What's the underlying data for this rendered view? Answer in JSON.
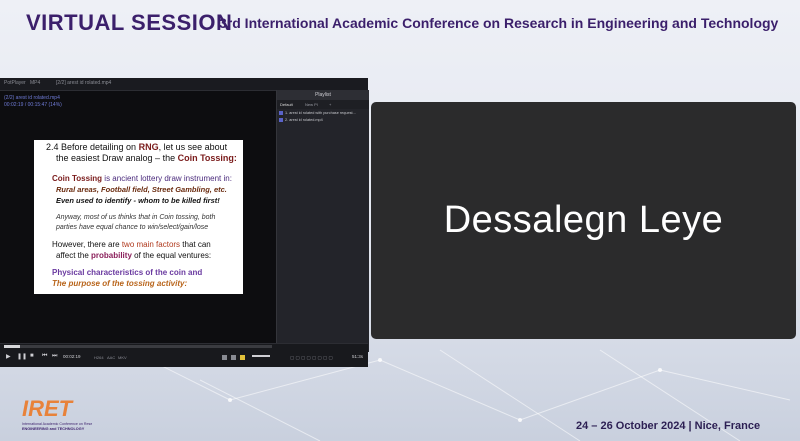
{
  "header": {
    "session": "VIRTUAL SESSION",
    "conference": "3rd International Academic Conference on Research in Engineering and Technology"
  },
  "player": {
    "app_name": "PotPlayer",
    "tab_label": "MP4",
    "file_title": "[2/2] arest id rolated.mp4",
    "overlay_line1": "(2/2) arest id rolated.mp4",
    "overlay_line2": "00:02:19 / 00:15:47 (14%)",
    "time": "00:02:19",
    "total": "00:15:47",
    "codecs": [
      "H264",
      "AAC",
      "MKV"
    ],
    "playlist": {
      "title": "Playlist",
      "tabs": [
        "Default",
        "New Pl",
        "+"
      ],
      "items": [
        {
          "label": "1. arest id rolated with purchase request...",
          "duration": "00:13:57"
        },
        {
          "label": "2. arest id rolated.mp4",
          "duration": "00:15:47"
        }
      ]
    },
    "status": {
      "audio": "51:3s"
    }
  },
  "slide": {
    "line1a": "2.4 Before detailing on ",
    "line1b": "RNG",
    "line1c": ", let  us see about",
    "line2a": "the easiest Draw analog – the ",
    "line2b": "Coin Tossing:",
    "p1a": "Coin Tossing",
    "p1b": " is ancient lottery draw instrument in:",
    "p2": "Rural areas, Football field, Street Gambling, etc.",
    "p3": "Even used to identify - whom to be killed first!",
    "p4a": "Anyway, most of us thinks that in Coin tossing, both",
    "p4b": "parties have equal chance to win/select/gain/lose",
    "p5a": "However, there are ",
    "p5b": "two main factors",
    "p5c": " that can",
    "p6a": "affect the ",
    "p6b": "probability",
    "p6c": " of the equal ventures:",
    "p7": "Physical characteristics of the coin and",
    "p8": "The purpose of the tossing activity:"
  },
  "participant": {
    "name": "Dessalegn  Leye"
  },
  "footer": {
    "dates": "24 – 26 October 2024 | Nice, France",
    "logo_text": "IRET",
    "logo_sub": "International Academic Conference on Research",
    "logo_sub2": "ENGINEERING and TECHNOLOGY"
  },
  "colors": {
    "brand": "#3b1f6b",
    "tile": "#2b2b2c",
    "logo_orange": "#e8823a"
  }
}
